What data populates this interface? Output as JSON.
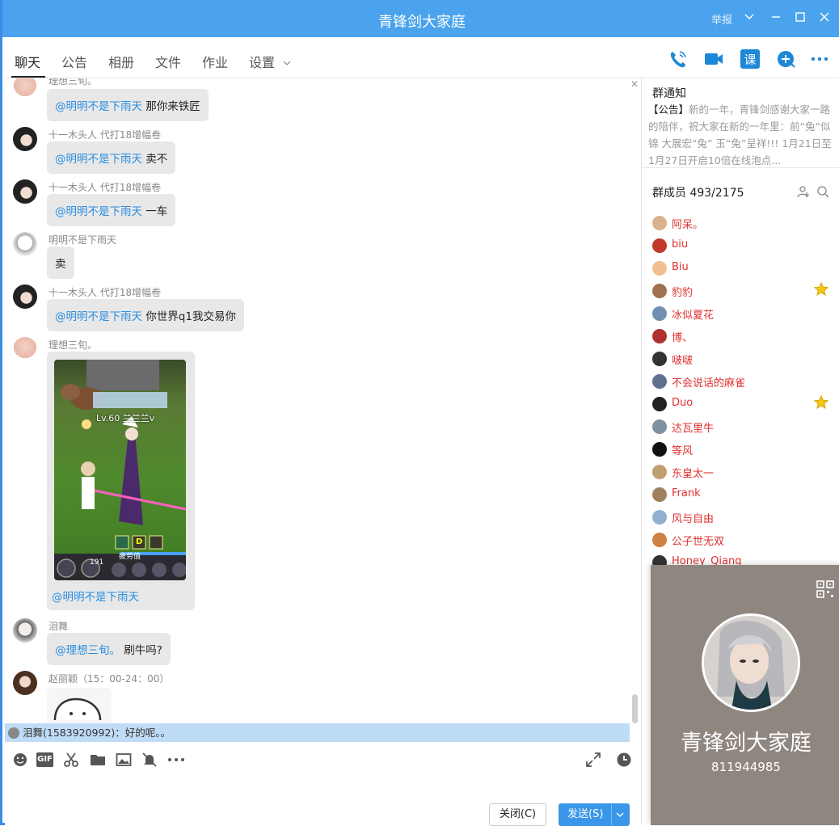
{
  "window": {
    "title": "青锋剑大家庭",
    "report_label": "举报"
  },
  "tabs": [
    {
      "label": "聊天"
    },
    {
      "label": "公告"
    },
    {
      "label": "相册"
    },
    {
      "label": "文件"
    },
    {
      "label": "作业"
    },
    {
      "label": "设置"
    }
  ],
  "toolbar": {
    "icons": [
      "phone-icon",
      "video-icon",
      "lesson-icon",
      "add-icon",
      "more-icon"
    ],
    "lesson_label": "课"
  },
  "messages": [
    {
      "sender": "理想三旬。",
      "mention": "@明明不是下雨天",
      "text": " 那你来铁匠"
    },
    {
      "sender": "十一木头人 代打18增幅卷",
      "mention": "@明明不是下雨天",
      "text": " 卖不"
    },
    {
      "sender": "十一木头人 代打18增幅卷",
      "mention": "@明明不是下雨天",
      "text": " 一车"
    },
    {
      "sender": "明明不是下雨天",
      "mention": "",
      "text": "卖"
    },
    {
      "sender": "十一木头人 代打18增幅卷",
      "mention": "@明明不是下雨天",
      "text": " 你世界q1我交易你"
    },
    {
      "sender": "理想三旬。",
      "image_caption": "Lv.60 兰兰兰v",
      "image_badge": "D",
      "image_sub": "疲劳值",
      "mention": "@明明不是下雨天",
      "text": ""
    },
    {
      "sender": "泪舞",
      "mention": "@理想三旬。",
      "text": " 刷牛吗?"
    },
    {
      "sender": "赵丽颖（15：00-24：00）",
      "mention": "",
      "text": ""
    }
  ],
  "game_image": {
    "level_text": "Lv.60 兰兰兰v",
    "skill_count": "191"
  },
  "notification": {
    "text": "泪舞(1583920992)：好的呢。。"
  },
  "composer": {
    "icons": [
      "emoji-icon",
      "gif-icon",
      "scissors-icon",
      "folder-icon",
      "image-icon",
      "mute-icon",
      "more-icon"
    ],
    "gif_label": "GIF",
    "close_label": "关闭(C)",
    "send_label": "发送(S)"
  },
  "sidebar": {
    "notice_title": "群通知",
    "notice_tag": "【公告】",
    "notice_text": "新的一年，青锋剑感谢大家一路的陪伴，祝大家在新的一年里：前“兔”似锦 大展宏“兔” 玉“兔”呈祥!!! 1月21日至1月27日开启10倍在线泡点...",
    "members_title": "群成员 493/2175",
    "members": [
      {
        "name": "阿呆。",
        "star": false,
        "color": "#d9b38c"
      },
      {
        "name": "biu",
        "star": false,
        "color": "#c0392b"
      },
      {
        "name": "Biu",
        "star": false,
        "color": "#f0c090"
      },
      {
        "name": "豹豹",
        "star": true,
        "color": "#a07050"
      },
      {
        "name": "冰似夏花",
        "star": false,
        "color": "#7090b0"
      },
      {
        "name": "博、",
        "star": false,
        "color": "#b03030"
      },
      {
        "name": "啵啵",
        "star": false,
        "color": "#333333"
      },
      {
        "name": "不会说话的麻雀",
        "star": false,
        "color": "#607090"
      },
      {
        "name": "Duo",
        "star": true,
        "color": "#222222"
      },
      {
        "name": "达瓦里牛",
        "star": false,
        "color": "#8090a0"
      },
      {
        "name": "等风",
        "star": false,
        "color": "#111111"
      },
      {
        "name": "东皇太一",
        "star": false,
        "color": "#c0a070"
      },
      {
        "name": "Frank",
        "star": false,
        "color": "#a08060"
      },
      {
        "name": "风与自由",
        "star": false,
        "color": "#90b0d0"
      },
      {
        "name": "公子世无双",
        "star": false,
        "color": "#d08040"
      },
      {
        "name": "Honey_Qiang",
        "star": false,
        "color": "#333333"
      }
    ]
  },
  "profile_card": {
    "name": "青锋剑大家庭",
    "id": "811944985"
  },
  "colors": {
    "accent": "#4aa3ec",
    "mention": "#2a8de0",
    "member_name": "#e03030",
    "card_bg": "#8f8680"
  }
}
